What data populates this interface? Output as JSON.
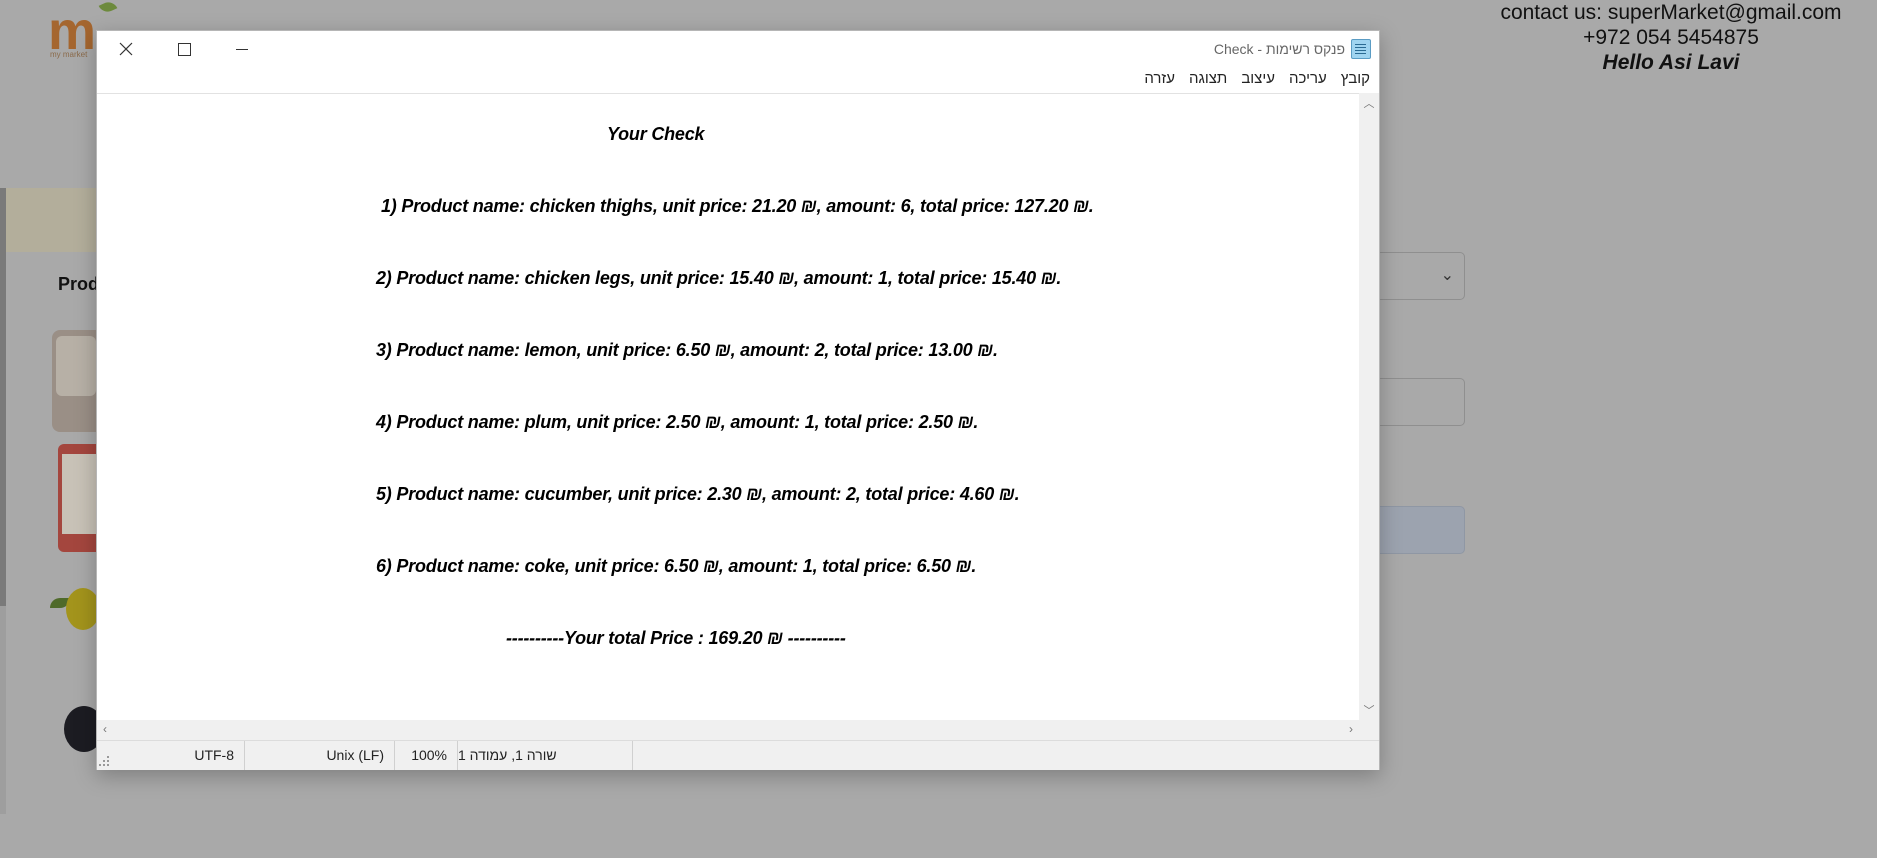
{
  "background": {
    "logo_sub": "my market",
    "contact_line": "contact us: superMarket@gmail.com",
    "phone": "+972 054 5454875",
    "greeting": "Hello Asi Lavi",
    "products_title": "Prod"
  },
  "window": {
    "title": "Check - פנקס רשימות",
    "menu": [
      "קובץ",
      "עריכה",
      "עיצוב",
      "תצוגה",
      "עזרה"
    ]
  },
  "document": {
    "heading": "Your Check",
    "lines": [
      "1) Product name: chicken thighs, unit price: 21.20 ₪,  amount: 6, total price: 127.20 ₪.",
      "2) Product name: chicken legs, unit price: 15.40 ₪,  amount: 1, total price: 15.40 ₪.",
      "3) Product name: lemon, unit price: 6.50 ₪,  amount: 2, total price: 13.00 ₪.",
      "4) Product name: plum, unit price: 2.50 ₪,  amount: 1, total price: 2.50 ₪.",
      "5) Product name: cucumber, unit price: 2.30 ₪,  amount: 2, total price: 4.60 ₪.",
      "6) Product name: coke, unit price: 6.50 ₪,  amount: 1, total price: 6.50 ₪."
    ],
    "total": "----------Your total Price : 169.20 ₪ ----------"
  },
  "status": {
    "position": "שורה 1, עמודה 1",
    "zoom": "100%",
    "line_ending": "Unix (LF)",
    "encoding": "UTF-8"
  }
}
